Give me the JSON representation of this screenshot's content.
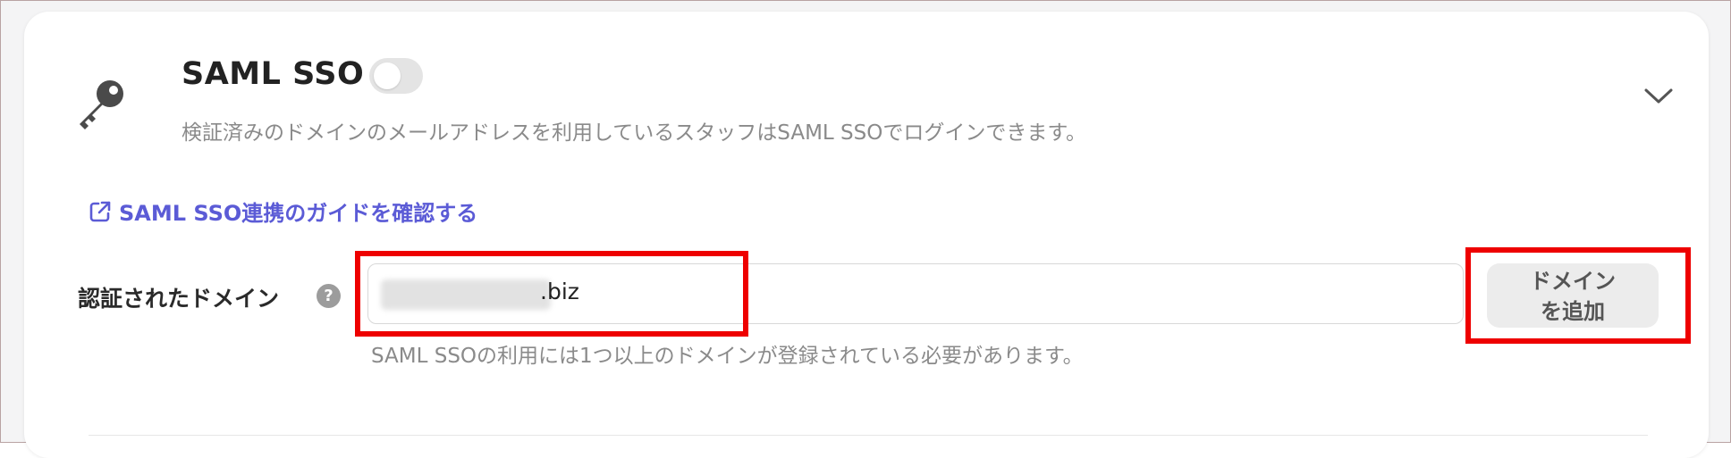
{
  "saml": {
    "title": "SAML SSO",
    "toggle_enabled": false,
    "description": "検証済みのドメインのメールアドレスを利用しているスタッフはSAML SSOでログインできます。",
    "guide_link_label": "SAML SSO連携のガイドを確認する"
  },
  "domain": {
    "label": "認証されたドメイン",
    "help_icon_glyph": "?",
    "input_value_suffix": ".biz",
    "add_button_line1": "ドメイン",
    "add_button_line2": "を追加",
    "helper_text": "SAML SSOの利用には1つ以上のドメインが登録されている必要があります。"
  },
  "icons": {
    "key": "key-icon",
    "chevron": "chevron-down-icon",
    "external_link": "external-link-icon",
    "help": "help-icon"
  },
  "colors": {
    "link": "#5b5bd6",
    "annotation": "#ee0000",
    "toggle_off": "#e4e4e4",
    "button_bg": "#ececec"
  }
}
